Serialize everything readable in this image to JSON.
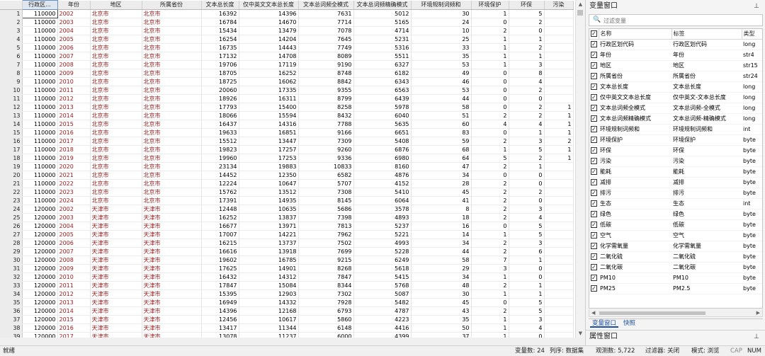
{
  "grid": {
    "columns": [
      "行政区...",
      "年份",
      "地区",
      "所属省份",
      "文本总长度",
      "仅中英文文本总长度",
      "文本总词频全模式",
      "文本总词频精确模式",
      "环境规制词频和",
      "环境保护",
      "环保",
      "污染"
    ],
    "rows": [
      [
        "1",
        "110000",
        "2002",
        "北京市",
        "北京市",
        "16392",
        "14396",
        "7631",
        "5012",
        "30",
        "1",
        "5",
        ""
      ],
      [
        "2",
        "110000",
        "2003",
        "北京市",
        "北京市",
        "16784",
        "14670",
        "7714",
        "5165",
        "24",
        "0",
        "2",
        ""
      ],
      [
        "3",
        "110000",
        "2004",
        "北京市",
        "北京市",
        "15434",
        "13479",
        "7078",
        "4714",
        "10",
        "2",
        "0",
        ""
      ],
      [
        "4",
        "110000",
        "2005",
        "北京市",
        "北京市",
        "16254",
        "14204",
        "7645",
        "5231",
        "25",
        "1",
        "1",
        ""
      ],
      [
        "5",
        "110000",
        "2006",
        "北京市",
        "北京市",
        "16735",
        "14443",
        "7749",
        "5316",
        "33",
        "1",
        "2",
        ""
      ],
      [
        "6",
        "110000",
        "2007",
        "北京市",
        "北京市",
        "17132",
        "14708",
        "8089",
        "5511",
        "35",
        "1",
        "1",
        ""
      ],
      [
        "7",
        "110000",
        "2008",
        "北京市",
        "北京市",
        "19706",
        "17119",
        "9190",
        "6327",
        "53",
        "1",
        "3",
        ""
      ],
      [
        "8",
        "110000",
        "2009",
        "北京市",
        "北京市",
        "18705",
        "16252",
        "8748",
        "6182",
        "49",
        "0",
        "8",
        ""
      ],
      [
        "9",
        "110000",
        "2010",
        "北京市",
        "北京市",
        "18725",
        "16062",
        "8842",
        "6343",
        "46",
        "0",
        "4",
        ""
      ],
      [
        "10",
        "110000",
        "2011",
        "北京市",
        "北京市",
        "20060",
        "17335",
        "9355",
        "6563",
        "53",
        "0",
        "2",
        ""
      ],
      [
        "11",
        "110000",
        "2012",
        "北京市",
        "北京市",
        "18926",
        "16311",
        "8799",
        "6439",
        "44",
        "0",
        "0",
        ""
      ],
      [
        "12",
        "110000",
        "2013",
        "北京市",
        "北京市",
        "17793",
        "15400",
        "8258",
        "5978",
        "58",
        "0",
        "2",
        "1"
      ],
      [
        "13",
        "110000",
        "2014",
        "北京市",
        "北京市",
        "18066",
        "15594",
        "8432",
        "6040",
        "51",
        "2",
        "2",
        "1"
      ],
      [
        "14",
        "110000",
        "2015",
        "北京市",
        "北京市",
        "16437",
        "14316",
        "7788",
        "5635",
        "60",
        "4",
        "4",
        "1"
      ],
      [
        "15",
        "110000",
        "2016",
        "北京市",
        "北京市",
        "19633",
        "16851",
        "9166",
        "6651",
        "83",
        "0",
        "1",
        "1"
      ],
      [
        "16",
        "110000",
        "2017",
        "北京市",
        "北京市",
        "15512",
        "13447",
        "7309",
        "5408",
        "59",
        "2",
        "3",
        "2"
      ],
      [
        "17",
        "110000",
        "2018",
        "北京市",
        "北京市",
        "19823",
        "17257",
        "9260",
        "6876",
        "68",
        "1",
        "5",
        "1"
      ],
      [
        "18",
        "110000",
        "2019",
        "北京市",
        "北京市",
        "19960",
        "17253",
        "9336",
        "6980",
        "64",
        "5",
        "2",
        "1"
      ],
      [
        "19",
        "110000",
        "2020",
        "北京市",
        "北京市",
        "23134",
        "19883",
        "10833",
        "8160",
        "47",
        "2",
        "1",
        ""
      ],
      [
        "20",
        "110000",
        "2021",
        "北京市",
        "北京市",
        "14452",
        "12350",
        "6582",
        "4876",
        "34",
        "0",
        "0",
        ""
      ],
      [
        "21",
        "110000",
        "2022",
        "北京市",
        "北京市",
        "12224",
        "10647",
        "5707",
        "4152",
        "28",
        "2",
        "0",
        ""
      ],
      [
        "22",
        "110000",
        "2023",
        "北京市",
        "北京市",
        "15762",
        "13512",
        "7308",
        "5410",
        "45",
        "2",
        "2",
        ""
      ],
      [
        "23",
        "110000",
        "2024",
        "北京市",
        "北京市",
        "17391",
        "14935",
        "8145",
        "6064",
        "41",
        "2",
        "0",
        ""
      ],
      [
        "24",
        "120000",
        "2002",
        "天津市",
        "天津市",
        "12448",
        "10635",
        "5686",
        "3578",
        "8",
        "2",
        "3",
        ""
      ],
      [
        "25",
        "120000",
        "2003",
        "天津市",
        "天津市",
        "16252",
        "13837",
        "7398",
        "4893",
        "18",
        "2",
        "4",
        ""
      ],
      [
        "26",
        "120000",
        "2004",
        "天津市",
        "天津市",
        "16677",
        "13971",
        "7813",
        "5237",
        "16",
        "0",
        "5",
        ""
      ],
      [
        "27",
        "120000",
        "2005",
        "天津市",
        "天津市",
        "17007",
        "14221",
        "7962",
        "5221",
        "14",
        "1",
        "5",
        ""
      ],
      [
        "28",
        "120000",
        "2006",
        "天津市",
        "天津市",
        "16215",
        "13737",
        "7502",
        "4993",
        "34",
        "2",
        "3",
        ""
      ],
      [
        "29",
        "120000",
        "2007",
        "天津市",
        "天津市",
        "16616",
        "13918",
        "7699",
        "5228",
        "44",
        "2",
        "6",
        ""
      ],
      [
        "30",
        "120000",
        "2008",
        "天津市",
        "天津市",
        "19602",
        "16785",
        "9215",
        "6249",
        "58",
        "7",
        "1",
        ""
      ],
      [
        "31",
        "120000",
        "2009",
        "天津市",
        "天津市",
        "17625",
        "14901",
        "8268",
        "5618",
        "29",
        "3",
        "0",
        ""
      ],
      [
        "32",
        "120000",
        "2010",
        "天津市",
        "天津市",
        "16432",
        "14312",
        "7847",
        "5415",
        "34",
        "1",
        "0",
        ""
      ],
      [
        "33",
        "120000",
        "2011",
        "天津市",
        "天津市",
        "17847",
        "15084",
        "8344",
        "5768",
        "48",
        "2",
        "1",
        ""
      ],
      [
        "34",
        "120000",
        "2012",
        "天津市",
        "天津市",
        "15395",
        "12903",
        "7302",
        "5087",
        "30",
        "1",
        "1",
        ""
      ],
      [
        "35",
        "120000",
        "2013",
        "天津市",
        "天津市",
        "16949",
        "14332",
        "7928",
        "5482",
        "45",
        "0",
        "5",
        ""
      ],
      [
        "36",
        "120000",
        "2014",
        "天津市",
        "天津市",
        "14396",
        "12168",
        "6793",
        "4787",
        "43",
        "2",
        "5",
        ""
      ],
      [
        "37",
        "120000",
        "2015",
        "天津市",
        "天津市",
        "12456",
        "10617",
        "5860",
        "4223",
        "35",
        "1",
        "3",
        ""
      ],
      [
        "38",
        "120000",
        "2016",
        "天津市",
        "天津市",
        "13417",
        "11344",
        "6148",
        "4416",
        "50",
        "1",
        "4",
        ""
      ],
      [
        "39",
        "120000",
        "2017",
        "天津市",
        "天津市",
        "13078",
        "11237",
        "6000",
        "4399",
        "37",
        "1",
        "0",
        ""
      ]
    ]
  },
  "variables_panel": {
    "title": "变量窗口",
    "filter_placeholder": "过滤变量",
    "headers": [
      "名称",
      "标签",
      "类型"
    ],
    "items": [
      {
        "name": "行政区划代码",
        "label": "行政区划代码",
        "type": "long"
      },
      {
        "name": "年份",
        "label": "年份",
        "type": "str4"
      },
      {
        "name": "地区",
        "label": "地区",
        "type": "str15"
      },
      {
        "name": "所属省份",
        "label": "所属省份",
        "type": "str24"
      },
      {
        "name": "文本总长度",
        "label": "文本总长度",
        "type": "long"
      },
      {
        "name": "仅中英文文本总长度",
        "label": "仅中英文-文本总长度",
        "type": "long"
      },
      {
        "name": "文本总词频全模式",
        "label": "文本总词频-全模式",
        "type": "long"
      },
      {
        "name": "文本总词频精确模式",
        "label": "文本总词频-精确模式",
        "type": "long"
      },
      {
        "name": "环境规制词频和",
        "label": "环境规制词频和",
        "type": "int"
      },
      {
        "name": "环境保护",
        "label": "环境保护",
        "type": "byte"
      },
      {
        "name": "环保",
        "label": "环保",
        "type": "byte"
      },
      {
        "name": "污染",
        "label": "污染",
        "type": "byte"
      },
      {
        "name": "能耗",
        "label": "能耗",
        "type": "byte"
      },
      {
        "name": "减排",
        "label": "减排",
        "type": "byte"
      },
      {
        "name": "排污",
        "label": "排污",
        "type": "byte"
      },
      {
        "name": "生态",
        "label": "生态",
        "type": "int"
      },
      {
        "name": "绿色",
        "label": "绿色",
        "type": "byte"
      },
      {
        "name": "低碳",
        "label": "低碳",
        "type": "byte"
      },
      {
        "name": "空气",
        "label": "空气",
        "type": "byte"
      },
      {
        "name": "化学需氧量",
        "label": "化学需氧量",
        "type": "byte"
      },
      {
        "name": "二氧化硫",
        "label": "二氧化硫",
        "type": "byte"
      },
      {
        "name": "二氧化碳",
        "label": "二氧化碳",
        "type": "byte"
      },
      {
        "name": "PM10",
        "label": "PM10",
        "type": "byte"
      },
      {
        "name": "PM25",
        "label": "PM2.5",
        "type": "byte"
      }
    ],
    "tabs": [
      "变量窗口",
      "快照"
    ]
  },
  "properties_panel": {
    "title": "属性窗口"
  },
  "status_bar": {
    "ready": "就绪",
    "var_count": "变量数: 24",
    "sort": "列序: 数据集",
    "obs_count": "观测数: 5,722",
    "filter": "过滤器: 关闭",
    "mode": "模式: 浏览",
    "cap": "CAP",
    "num": "NUM"
  },
  "colors": {
    "red_text": "#a01c1c",
    "accent": "#1d4f9c"
  }
}
